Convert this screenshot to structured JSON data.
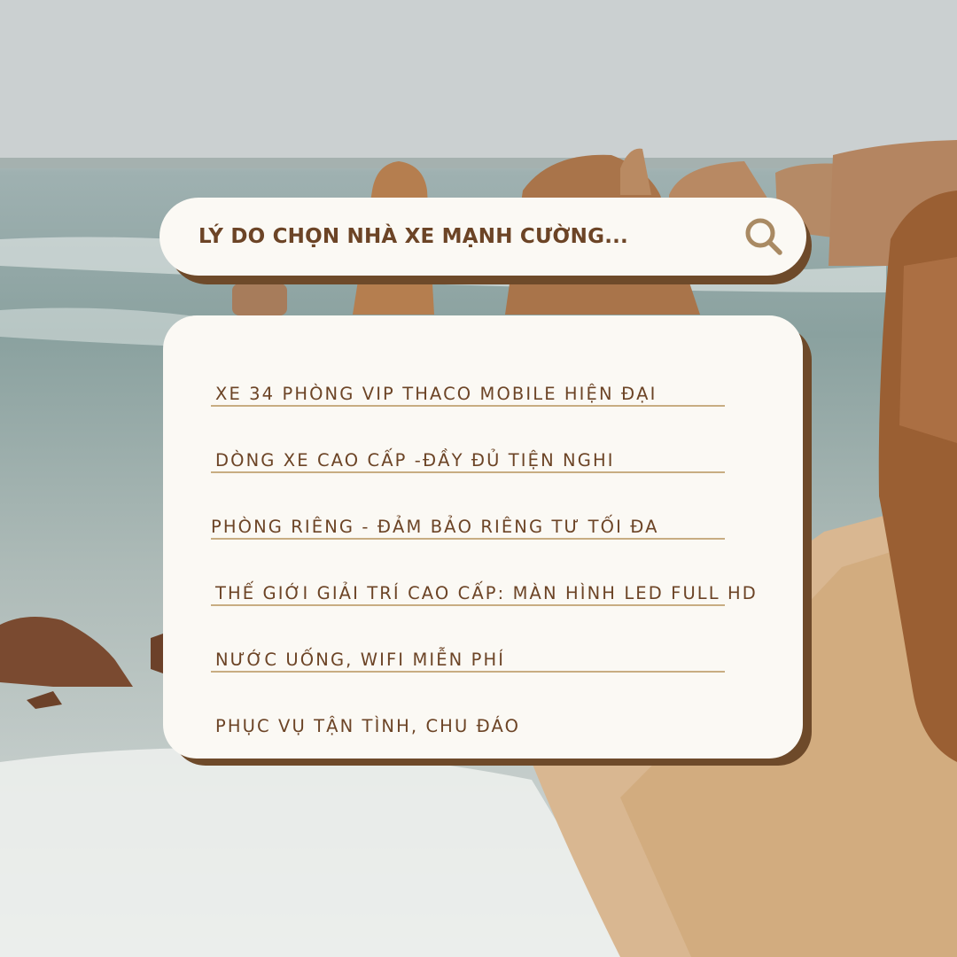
{
  "search": {
    "query": "LÝ DO CHỌN NHÀ XE MẠNH CƯỜNG...",
    "icon": "search-icon"
  },
  "reasons": {
    "items": [
      {
        "label": "XE 34 PHÒNG VIP THACO MOBILE HIỆN ĐẠI"
      },
      {
        "label": "DÒNG XE CAO CẤP -ĐẦY ĐỦ TIỆN NGHI"
      },
      {
        "label": "PHÒNG RIÊNG - ĐẢM BẢO RIÊNG TƯ TỐI ĐA"
      },
      {
        "label": "THẾ GIỚI GIẢI TRÍ CAO CẤP: MÀN HÌNH LED FULL HD"
      },
      {
        "label": "NƯỚC UỐNG, WIFI MIỄN PHÍ"
      },
      {
        "label": "PHỤC VỤ TẬN TÌNH, CHU ĐÁO"
      }
    ]
  },
  "colors": {
    "accent_brown": "#6c4426",
    "shadow_brown": "#6e4a2a",
    "divider_tan": "#c8ad82",
    "card_bg": "#fbf9f4",
    "icon_tan": "#a98a63"
  }
}
